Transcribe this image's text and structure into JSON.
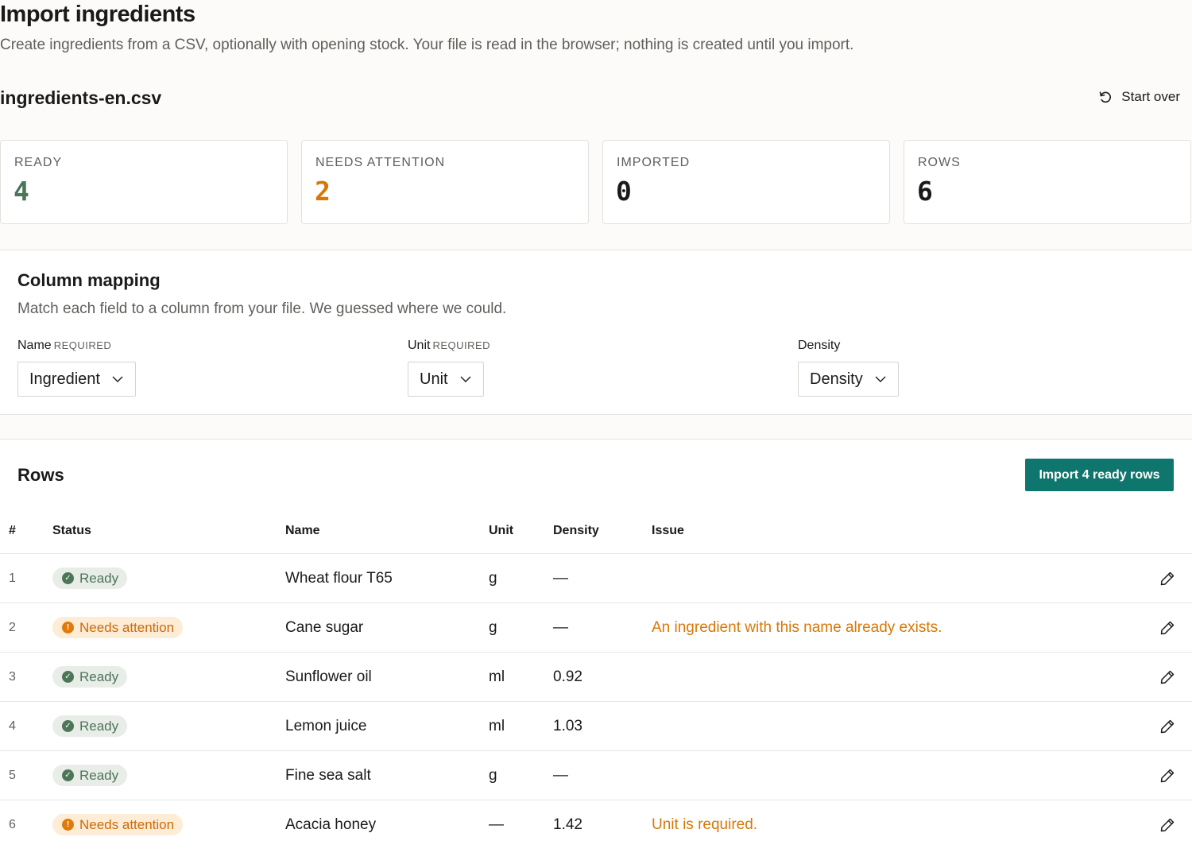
{
  "header": {
    "title": "Import ingredients",
    "subtitle": "Create ingredients from a CSV, optionally with opening stock. Your file is read in the browser; nothing is created until you import."
  },
  "file": {
    "name": "ingredients-en.csv",
    "start_over_label": "Start over"
  },
  "stats": [
    {
      "label": "READY",
      "value": "4",
      "color": "#4d7558"
    },
    {
      "label": "NEEDS ATTENTION",
      "value": "2",
      "color": "#d97706"
    },
    {
      "label": "IMPORTED",
      "value": "0",
      "color": "#1a1a1a"
    },
    {
      "label": "ROWS",
      "value": "6",
      "color": "#1a1a1a"
    }
  ],
  "mapping": {
    "title": "Column mapping",
    "description": "Match each field to a column from your file. We guessed where we could.",
    "fields": [
      {
        "label": "Name",
        "required": "REQUIRED",
        "selected": "Ingredient"
      },
      {
        "label": "Unit",
        "required": "REQUIRED",
        "selected": "Unit"
      },
      {
        "label": "Density",
        "required": "",
        "selected": "Density"
      }
    ]
  },
  "rows_section": {
    "title": "Rows",
    "import_button": "Import 4 ready rows",
    "accent": "#0f766e",
    "columns": [
      "#",
      "Status",
      "Name",
      "Unit",
      "Density",
      "Issue"
    ],
    "rows": [
      {
        "num": "1",
        "status": "Ready",
        "status_type": "ready",
        "name": "Wheat flour T65",
        "unit": "g",
        "density": "—",
        "issue": ""
      },
      {
        "num": "2",
        "status": "Needs attention",
        "status_type": "attention",
        "name": "Cane sugar",
        "unit": "g",
        "density": "—",
        "issue": "An ingredient with this name already exists."
      },
      {
        "num": "3",
        "status": "Ready",
        "status_type": "ready",
        "name": "Sunflower oil",
        "unit": "ml",
        "density": "0.92",
        "issue": ""
      },
      {
        "num": "4",
        "status": "Ready",
        "status_type": "ready",
        "name": "Lemon juice",
        "unit": "ml",
        "density": "1.03",
        "issue": ""
      },
      {
        "num": "5",
        "status": "Ready",
        "status_type": "ready",
        "name": "Fine sea salt",
        "unit": "g",
        "density": "—",
        "issue": ""
      },
      {
        "num": "6",
        "status": "Needs attention",
        "status_type": "attention",
        "name": "Acacia honey",
        "unit": "—",
        "density": "1.42",
        "issue": "Unit is required."
      }
    ]
  },
  "icons": {
    "start_over": "refresh-icon",
    "select": "chevron-down-icon",
    "edit": "pencil-icon",
    "ready": "check-circle-icon",
    "attention": "alert-circle-icon"
  }
}
